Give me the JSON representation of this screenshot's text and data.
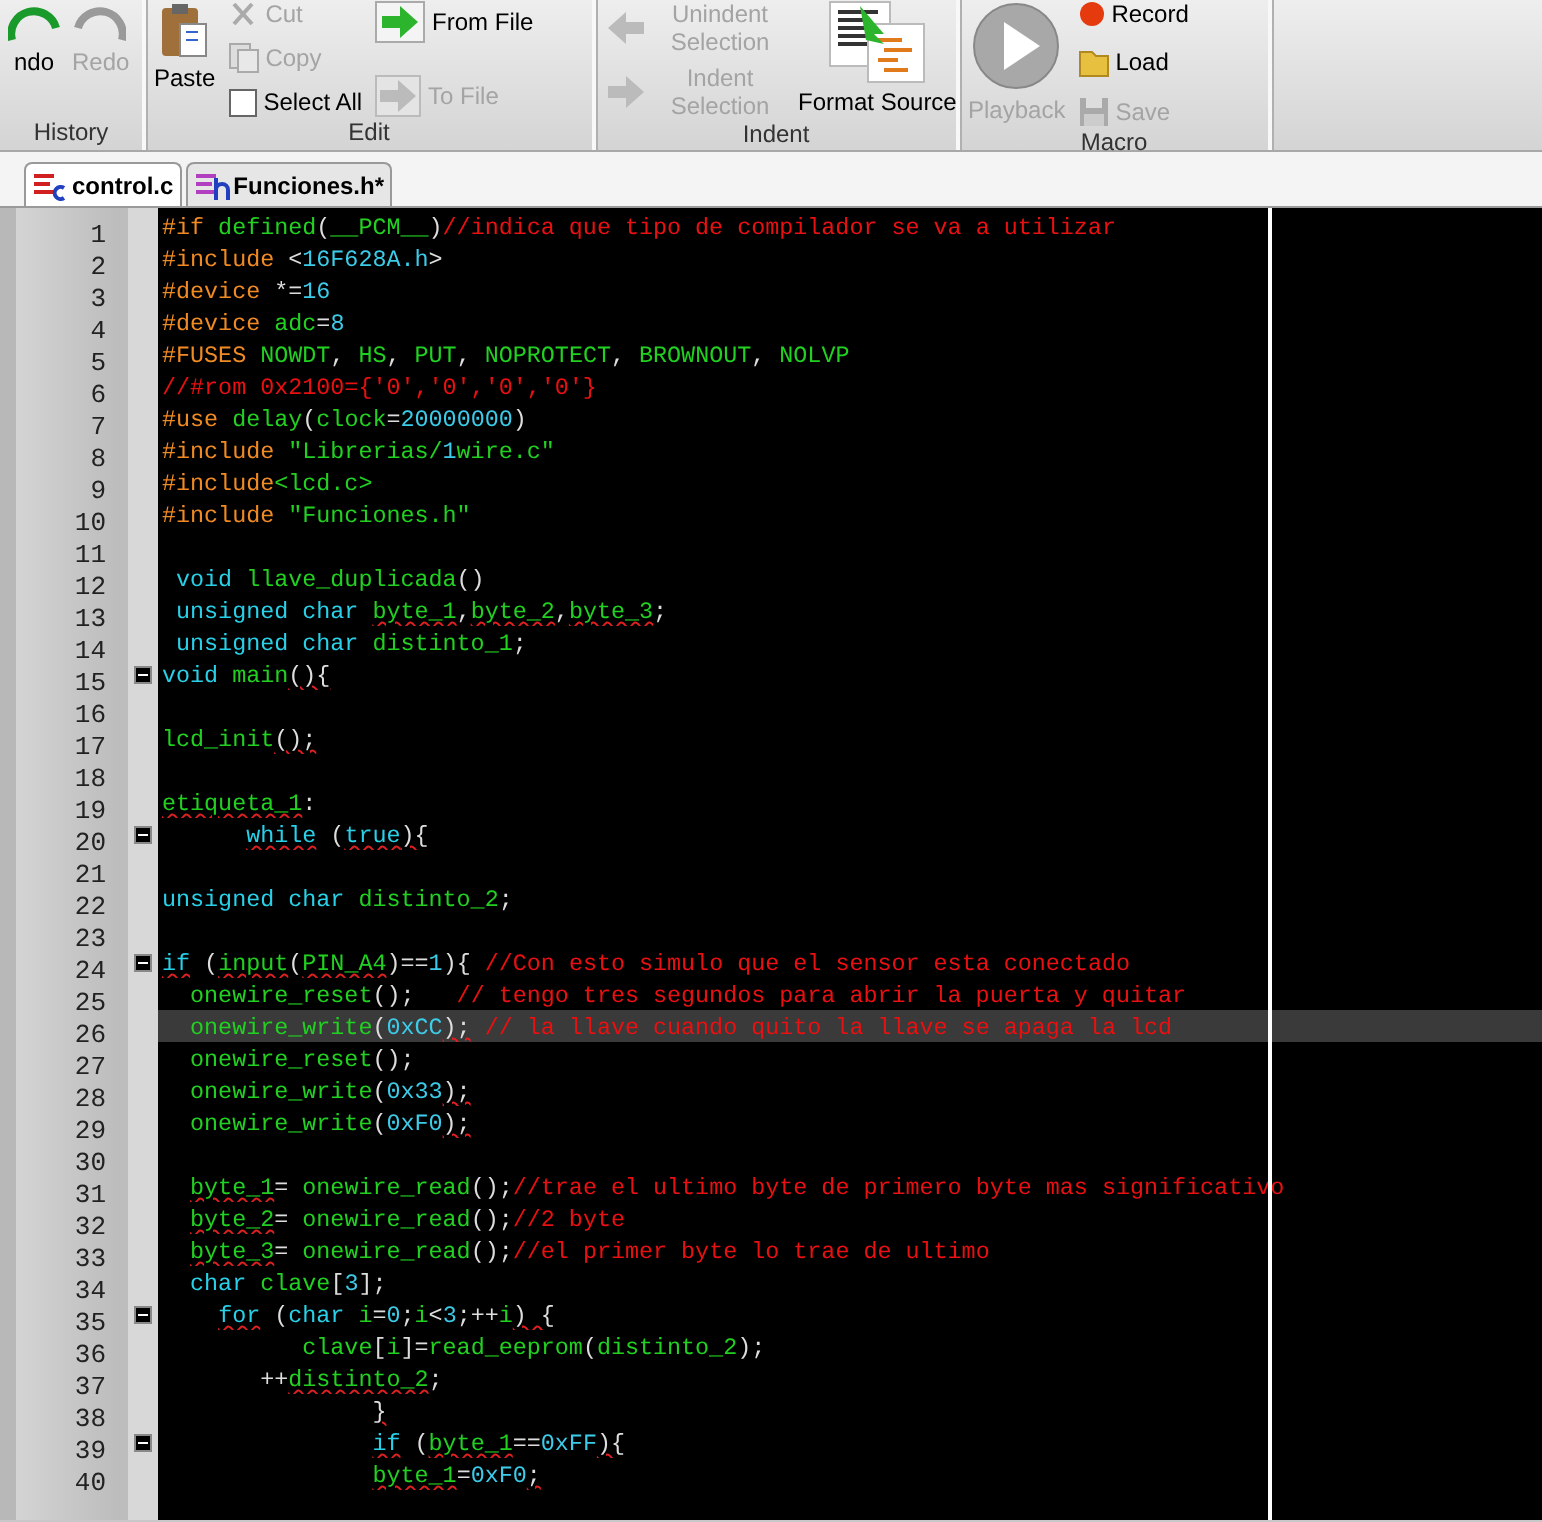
{
  "ribbon": {
    "groups": [
      {
        "label": "History",
        "items": [
          {
            "label": "ndo",
            "disabled": false
          },
          {
            "label": "Redo",
            "disabled": true
          }
        ]
      },
      {
        "label": "Edit",
        "items": [
          {
            "label": "Paste",
            "disabled": false
          },
          {
            "label": "Cut",
            "disabled": true
          },
          {
            "label": "Copy",
            "disabled": true
          },
          {
            "label": "Select All",
            "disabled": false
          },
          {
            "label": "From File",
            "disabled": false
          },
          {
            "label": "To File",
            "disabled": true
          }
        ]
      },
      {
        "label": "Indent",
        "items": [
          {
            "label": "Unindent Selection",
            "disabled": true
          },
          {
            "label": "Indent Selection",
            "disabled": true
          },
          {
            "label": "Format Source",
            "disabled": false
          }
        ]
      },
      {
        "label": "Macro",
        "items": [
          {
            "label": "Playback",
            "disabled": true
          },
          {
            "label": "Record",
            "disabled": false
          },
          {
            "label": "Load",
            "disabled": false
          },
          {
            "label": "Save",
            "disabled": true
          }
        ]
      }
    ]
  },
  "tabs": [
    {
      "label": "control.c",
      "selected": true
    },
    {
      "label": "Funciones.h*",
      "selected": false
    }
  ],
  "lines": [
    {
      "n": "1",
      "tokens": [
        {
          "kind": "pp",
          "text": "#if"
        },
        {
          "kind": "id",
          "text": " defined"
        },
        {
          "kind": "op",
          "text": "("
        },
        {
          "kind": "id",
          "text": "__PCM__"
        },
        {
          "kind": "op",
          "text": ")"
        },
        {
          "kind": "cm",
          "text": "//indica que tipo de compilador se va a utilizar"
        }
      ]
    },
    {
      "n": "2",
      "tokens": [
        {
          "kind": "pp",
          "text": "#include"
        },
        {
          "kind": "op",
          "text": " <"
        },
        {
          "kind": "num",
          "text": "16F628A.h"
        },
        {
          "kind": "op",
          "text": ">"
        }
      ]
    },
    {
      "n": "3",
      "tokens": [
        {
          "kind": "pp",
          "text": "#device"
        },
        {
          "kind": "op",
          "text": " *="
        },
        {
          "kind": "num",
          "text": "16"
        }
      ]
    },
    {
      "n": "4",
      "tokens": [
        {
          "kind": "pp",
          "text": "#device"
        },
        {
          "kind": "id",
          "text": " adc"
        },
        {
          "kind": "op",
          "text": "="
        },
        {
          "kind": "num",
          "text": "8"
        }
      ]
    },
    {
      "n": "5",
      "tokens": [
        {
          "kind": "pp",
          "text": "#FUSES"
        },
        {
          "kind": "id",
          "text": " NOWDT"
        },
        {
          "kind": "op",
          "text": ","
        },
        {
          "kind": "id",
          "text": " HS"
        },
        {
          "kind": "op",
          "text": ","
        },
        {
          "kind": "id",
          "text": " PUT"
        },
        {
          "kind": "op",
          "text": ","
        },
        {
          "kind": "id",
          "text": " NOPROTECT"
        },
        {
          "kind": "op",
          "text": ","
        },
        {
          "kind": "id",
          "text": " BROWNOUT"
        },
        {
          "kind": "op",
          "text": ","
        },
        {
          "kind": "id",
          "text": " NOLVP"
        }
      ]
    },
    {
      "n": "6",
      "tokens": [
        {
          "kind": "cm",
          "text": "//#rom 0x2100={'0','0','0','0'}"
        }
      ]
    },
    {
      "n": "7",
      "tokens": [
        {
          "kind": "pp",
          "text": "#use"
        },
        {
          "kind": "id",
          "text": " delay"
        },
        {
          "kind": "op",
          "text": "("
        },
        {
          "kind": "id",
          "text": "clock"
        },
        {
          "kind": "op",
          "text": "="
        },
        {
          "kind": "num",
          "text": "20000000"
        },
        {
          "kind": "op",
          "text": ")"
        }
      ]
    },
    {
      "n": "8",
      "tokens": [
        {
          "kind": "pp",
          "text": "#include"
        },
        {
          "kind": "id",
          "text": " \"Librerias/"
        },
        {
          "kind": "num",
          "text": "1"
        },
        {
          "kind": "id",
          "text": "wire.c\""
        }
      ]
    },
    {
      "n": "9",
      "tokens": [
        {
          "kind": "pp",
          "text": "#include"
        },
        {
          "kind": "id",
          "text": "<lcd.c>"
        }
      ]
    },
    {
      "n": "10",
      "tokens": [
        {
          "kind": "pp",
          "text": "#include"
        },
        {
          "kind": "id",
          "text": " \"Funciones.h\""
        }
      ]
    },
    {
      "n": "11"
    },
    {
      "n": "12",
      "tokens": [
        {
          "kind": "kw",
          "text": " void"
        },
        {
          "kind": "id",
          "text": " llave_duplicada"
        },
        {
          "kind": "op",
          "text": "()"
        }
      ]
    },
    {
      "n": "13",
      "tokens": [
        {
          "kind": "kw",
          "text": " unsigned char"
        },
        {
          "kind": "id",
          "text": " byte_1",
          "sq": true
        },
        {
          "kind": "op",
          "text": ","
        },
        {
          "kind": "id",
          "text": "byte_2",
          "sq": true
        },
        {
          "kind": "op",
          "text": ","
        },
        {
          "kind": "id",
          "text": "byte_3",
          "sq": true
        },
        {
          "kind": "op",
          "text": ";"
        }
      ]
    },
    {
      "n": "14",
      "tokens": [
        {
          "kind": "kw",
          "text": " unsigned char"
        },
        {
          "kind": "id",
          "text": " distinto_1"
        },
        {
          "kind": "op",
          "text": ";"
        }
      ]
    },
    {
      "n": "15",
      "fold": true,
      "tokens": [
        {
          "kind": "kw",
          "text": "void"
        },
        {
          "kind": "id",
          "text": " main"
        },
        {
          "kind": "op",
          "text": "(){",
          "sq": true
        }
      ]
    },
    {
      "n": "16"
    },
    {
      "n": "17",
      "tokens": [
        {
          "kind": "id",
          "text": "lcd_init"
        },
        {
          "kind": "op",
          "text": "();",
          "sq": true
        }
      ]
    },
    {
      "n": "18"
    },
    {
      "n": "19",
      "tokens": [
        {
          "kind": "id",
          "text": "etiqueta_1",
          "sq": true
        },
        {
          "kind": "op",
          "text": ":"
        }
      ]
    },
    {
      "n": "20",
      "fold": true,
      "tokens": [
        {
          "kind": "kw",
          "text": "      while",
          "sq": true
        },
        {
          "kind": "op",
          "text": " ("
        },
        {
          "kind": "kw",
          "text": "true",
          "sq": true
        },
        {
          "kind": "op",
          "text": "){",
          "sq": true
        }
      ]
    },
    {
      "n": "21"
    },
    {
      "n": "22",
      "tokens": [
        {
          "kind": "kw",
          "text": "unsigned char"
        },
        {
          "kind": "id",
          "text": " distinto_2"
        },
        {
          "kind": "op",
          "text": ";"
        }
      ]
    },
    {
      "n": "23"
    },
    {
      "n": "24",
      "fold": true,
      "tokens": [
        {
          "kind": "kw",
          "text": "if",
          "sq": true
        },
        {
          "kind": "op",
          "text": " ("
        },
        {
          "kind": "id",
          "text": "input",
          "sq": true
        },
        {
          "kind": "op",
          "text": "("
        },
        {
          "kind": "id",
          "text": "PIN_A4",
          "sq": true
        },
        {
          "kind": "op",
          "text": ")=="
        },
        {
          "kind": "num",
          "text": "1"
        },
        {
          "kind": "op",
          "text": "){"
        },
        {
          "kind": "cm",
          "text": " //Con esto simulo que el sensor esta conectado"
        }
      ]
    },
    {
      "n": "25",
      "tokens": [
        {
          "kind": "id",
          "text": "  onewire_reset"
        },
        {
          "kind": "op",
          "text": "();"
        },
        {
          "kind": "cm",
          "text": "   // tengo tres segundos para abrir la puerta y quitar"
        }
      ]
    },
    {
      "n": "26",
      "current": true,
      "tokens": [
        {
          "kind": "id",
          "text": "  onewire_write"
        },
        {
          "kind": "op",
          "text": "("
        },
        {
          "kind": "num",
          "text": "0xCC"
        },
        {
          "kind": "op",
          "text": ");",
          "sq": true
        },
        {
          "kind": "cm",
          "text": " // la llave cuando quito la llave se apaga la lcd"
        }
      ]
    },
    {
      "n": "27",
      "tokens": [
        {
          "kind": "id",
          "text": "  onewire_reset"
        },
        {
          "kind": "op",
          "text": "();"
        }
      ]
    },
    {
      "n": "28",
      "tokens": [
        {
          "kind": "id",
          "text": "  onewire_write"
        },
        {
          "kind": "op",
          "text": "("
        },
        {
          "kind": "num",
          "text": "0x33"
        },
        {
          "kind": "op",
          "text": ");",
          "sq": true
        }
      ]
    },
    {
      "n": "29",
      "tokens": [
        {
          "kind": "id",
          "text": "  onewire_write"
        },
        {
          "kind": "op",
          "text": "("
        },
        {
          "kind": "num",
          "text": "0xF0"
        },
        {
          "kind": "op",
          "text": ");",
          "sq": true
        }
      ]
    },
    {
      "n": "30"
    },
    {
      "n": "31",
      "tokens": [
        {
          "kind": "id",
          "text": "  byte_1",
          "sq": true
        },
        {
          "kind": "op",
          "text": "= "
        },
        {
          "kind": "id",
          "text": "onewire_read"
        },
        {
          "kind": "op",
          "text": "();"
        },
        {
          "kind": "cm",
          "text": "//trae el ultimo byte de primero byte mas significativo"
        }
      ]
    },
    {
      "n": "32",
      "tokens": [
        {
          "kind": "id",
          "text": "  byte_2",
          "sq": true
        },
        {
          "kind": "op",
          "text": "= "
        },
        {
          "kind": "id",
          "text": "onewire_read"
        },
        {
          "kind": "op",
          "text": "();"
        },
        {
          "kind": "cm",
          "text": "//2 byte"
        }
      ]
    },
    {
      "n": "33",
      "tokens": [
        {
          "kind": "id",
          "text": "  byte_3",
          "sq": true
        },
        {
          "kind": "op",
          "text": "= "
        },
        {
          "kind": "id",
          "text": "onewire_read"
        },
        {
          "kind": "op",
          "text": "();"
        },
        {
          "kind": "cm",
          "text": "//el primer byte lo trae de ultimo"
        }
      ]
    },
    {
      "n": "34",
      "tokens": [
        {
          "kind": "kw",
          "text": "  char"
        },
        {
          "kind": "id",
          "text": " clave"
        },
        {
          "kind": "op",
          "text": "["
        },
        {
          "kind": "num",
          "text": "3"
        },
        {
          "kind": "op",
          "text": "];"
        }
      ]
    },
    {
      "n": "35",
      "fold": true,
      "tokens": [
        {
          "kind": "kw",
          "text": "    for",
          "sq": true
        },
        {
          "kind": "op",
          "text": " ("
        },
        {
          "kind": "kw",
          "text": "char"
        },
        {
          "kind": "id",
          "text": " i"
        },
        {
          "kind": "op",
          "text": "="
        },
        {
          "kind": "num",
          "text": "0"
        },
        {
          "kind": "op",
          "text": ";"
        },
        {
          "kind": "id",
          "text": "i"
        },
        {
          "kind": "op",
          "text": "<"
        },
        {
          "kind": "num",
          "text": "3"
        },
        {
          "kind": "op",
          "text": ";++"
        },
        {
          "kind": "id",
          "text": "i"
        },
        {
          "kind": "op",
          "text": ") {",
          "sq": true
        }
      ]
    },
    {
      "n": "36",
      "tokens": [
        {
          "kind": "id",
          "text": "          clave"
        },
        {
          "kind": "op",
          "text": "["
        },
        {
          "kind": "id",
          "text": "i"
        },
        {
          "kind": "op",
          "text": "]="
        },
        {
          "kind": "id",
          "text": "read_eeprom"
        },
        {
          "kind": "op",
          "text": "("
        },
        {
          "kind": "id",
          "text": "distinto_2"
        },
        {
          "kind": "op",
          "text": ");"
        }
      ]
    },
    {
      "n": "37",
      "tokens": [
        {
          "kind": "op",
          "text": "       ++"
        },
        {
          "kind": "id",
          "text": "distinto_2",
          "sq": true
        },
        {
          "kind": "op",
          "text": ";"
        }
      ]
    },
    {
      "n": "38",
      "tokens": [
        {
          "kind": "op",
          "text": "               }",
          "sq": true
        }
      ]
    },
    {
      "n": "39",
      "fold": true,
      "tokens": [
        {
          "kind": "kw",
          "text": "               if",
          "sq": true
        },
        {
          "kind": "op",
          "text": " ("
        },
        {
          "kind": "id",
          "text": "byte_1",
          "sq": true
        },
        {
          "kind": "op",
          "text": "=="
        },
        {
          "kind": "num",
          "text": "0xFF"
        },
        {
          "kind": "op",
          "text": "){",
          "sq": true
        }
      ]
    },
    {
      "n": "40",
      "tokens": [
        {
          "kind": "id",
          "text": "               byte_1",
          "sq": true
        },
        {
          "kind": "op",
          "text": "="
        },
        {
          "kind": "num",
          "text": "0xF0"
        },
        {
          "kind": "op",
          "text": ";",
          "sq": true
        }
      ]
    }
  ]
}
